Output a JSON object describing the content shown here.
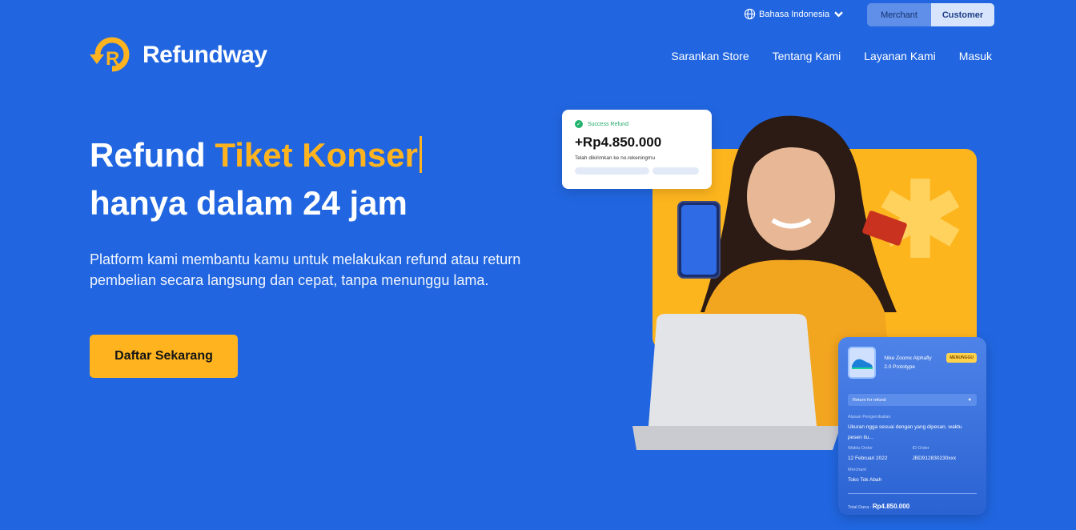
{
  "header": {
    "language": "Bahasa Indonesia",
    "roles": [
      "Merchant",
      "Customer"
    ],
    "active_role": "Customer",
    "brand": "Refundway",
    "nav": [
      "Sarankan Store",
      "Tentang Kami",
      "Layanan Kami",
      "Masuk"
    ]
  },
  "hero": {
    "title_prefix": "Refund ",
    "title_accent": "Tiket Konser",
    "title_line2": "hanya dalam 24 jam",
    "subtitle": "Platform kami membantu kamu untuk melakukan refund atau return pembelian secara langsung dan cepat, tanpa menunggu lama.",
    "cta": "Daftar Sekarang"
  },
  "success_card": {
    "status": "Success Refund",
    "amount": "+Rp4.850.000",
    "note": "Telah dikirimkan ke no.rekeningmu"
  },
  "order_card": {
    "product": "Nike Zoomx Alphafly 2.0 Prototype",
    "badge": "MENUNGGU",
    "select_value": "Return for refund",
    "reason_label": "Alasan Pengembalian",
    "reason": "Ukuran ngga sesuai dengan yang dipesan, waktu pesen itu...",
    "date_label": "Waktu Order",
    "date": "12 Februari 2022",
    "id_label": "ID Order",
    "id": "JBD912830230xxx",
    "merchant_label": "Merchant",
    "merchant": "Toko Tok Abah",
    "total_label": "Total Dana :",
    "total": "Rp4.850.000"
  },
  "colors": {
    "background": "#2166E0",
    "accent": "#FFB41F",
    "success": "#21B36E"
  },
  "icons": [
    "globe-icon",
    "chevron-down-icon",
    "check-icon",
    "dropdown-caret-icon",
    "shoe-icon"
  ]
}
